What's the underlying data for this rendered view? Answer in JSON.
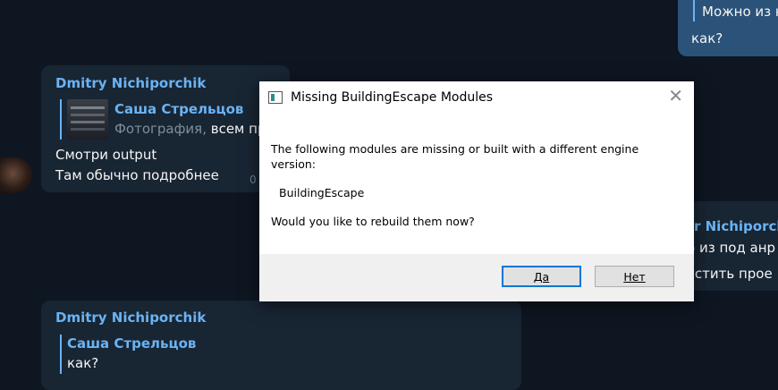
{
  "top_right_message": {
    "reply_text": "Можно из н",
    "text": "как?"
  },
  "message1": {
    "sender": "Dmitry Nichiporchik",
    "reply_name": "Саша Стрельцов",
    "reply_prefix": "Фотография, ",
    "reply_text": "всем пр",
    "lines": [
      "Смотри output",
      "Там обычно подробнее"
    ],
    "time": "0"
  },
  "right_message": {
    "sender": "r Nichiporchi",
    "reply_text": "о из под анр",
    "text": "устить прое"
  },
  "message2": {
    "sender": "Dmitry Nichiporchik",
    "reply_name": "Саша Стрельцов",
    "reply_text": "как?"
  },
  "dialog": {
    "title": "Missing BuildingEscape Modules",
    "line1": "The following modules are missing or built with a different engine",
    "line2": "version:",
    "module": "BuildingEscape",
    "question": "Would you like to rebuild them now?",
    "yes_label": "Да",
    "no_label": "Нет",
    "close_glyph": "✕"
  },
  "colors": {
    "background": "#0e1621",
    "bubble": "#182533",
    "accent": "#6ab3f3",
    "dialog_primary_border": "#0078d7"
  }
}
